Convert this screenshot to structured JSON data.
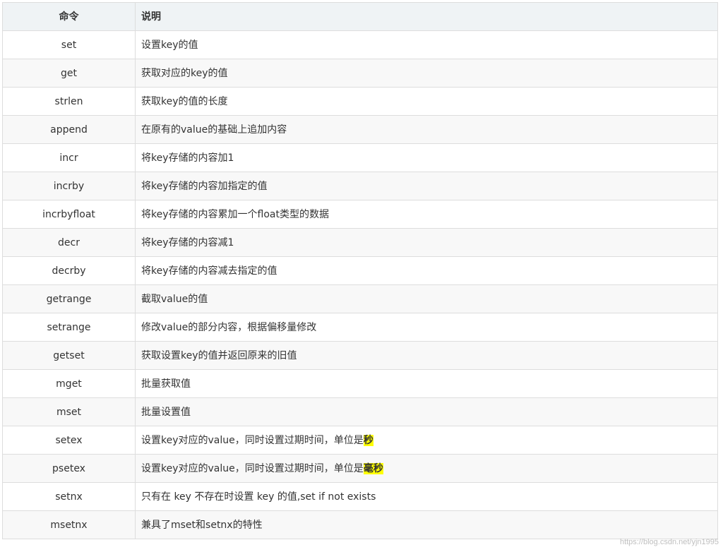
{
  "table": {
    "headers": {
      "command": "命令",
      "description": "说明"
    },
    "rows": [
      {
        "command": "set",
        "description": "设置key的值",
        "highlight": ""
      },
      {
        "command": "get",
        "description": "获取对应的key的值",
        "highlight": ""
      },
      {
        "command": "strlen",
        "description": "获取key的值的长度",
        "highlight": ""
      },
      {
        "command": "append",
        "description": "在原有的value的基础上追加内容",
        "highlight": ""
      },
      {
        "command": "incr",
        "description": "将key存储的内容加1",
        "highlight": ""
      },
      {
        "command": "incrby",
        "description": "将key存储的内容加指定的值",
        "highlight": ""
      },
      {
        "command": "incrbyfloat",
        "description": "将key存储的内容累加一个float类型的数据",
        "highlight": ""
      },
      {
        "command": "decr",
        "description": "将key存储的内容减1",
        "highlight": ""
      },
      {
        "command": "decrby",
        "description": "将key存储的内容减去指定的值",
        "highlight": ""
      },
      {
        "command": "getrange",
        "description": "截取value的值",
        "highlight": ""
      },
      {
        "command": "setrange",
        "description": "修改value的部分内容，根据偏移量修改",
        "highlight": ""
      },
      {
        "command": "getset",
        "description": "获取设置key的值并返回原来的旧值",
        "highlight": ""
      },
      {
        "command": "mget",
        "description": "批量获取值",
        "highlight": ""
      },
      {
        "command": "mset",
        "description": "批量设置值",
        "highlight": ""
      },
      {
        "command": "setex",
        "description": "设置key对应的value，同时设置过期时间，单位是",
        "highlight": "秒"
      },
      {
        "command": "psetex",
        "description": "设置key对应的value，同时设置过期时间，单位是",
        "highlight": "毫秒"
      },
      {
        "command": "setnx",
        "description": "只有在 key 不存在时设置 key 的值,set if not exists",
        "highlight": ""
      },
      {
        "command": "msetnx",
        "description": "兼具了mset和setnx的特性",
        "highlight": ""
      }
    ]
  },
  "watermark": "https://blog.csdn.net/yjn1995",
  "colors": {
    "header_bg": "#eff3f5",
    "row_alt_bg": "#f8f8f8",
    "border": "#dddddd",
    "highlight": "#ffff00"
  }
}
